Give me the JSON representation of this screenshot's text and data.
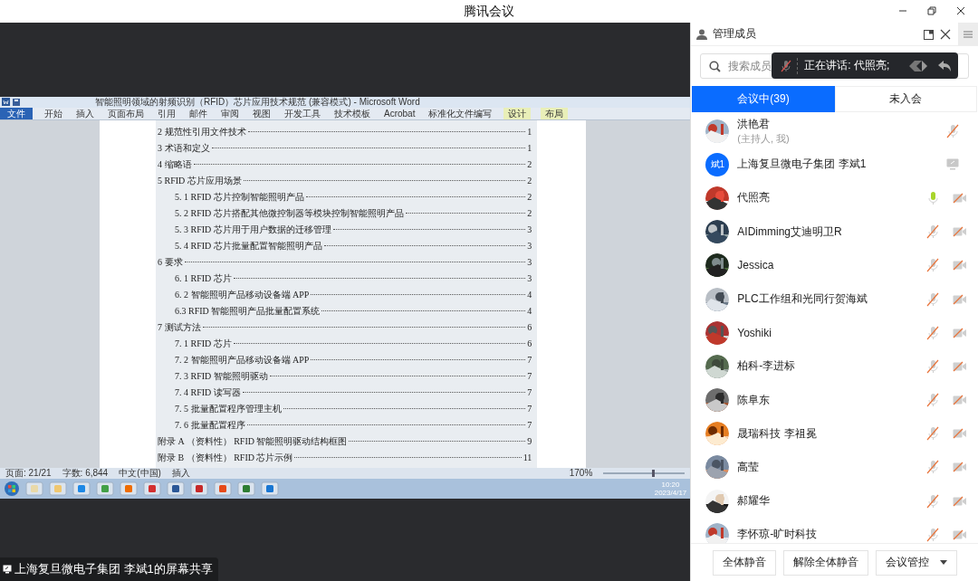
{
  "window": {
    "title": "腾讯会议"
  },
  "shared_screen": {
    "word_title": "智能照明领域的射频识别（RFID）芯片应用技术规范 (兼容模式) - Microsoft Word",
    "ribbon_tabs": [
      {
        "label": "文件",
        "kind": "file"
      },
      {
        "label": "开始",
        "kind": "tab"
      },
      {
        "label": "插入",
        "kind": "tab"
      },
      {
        "label": "页面布局",
        "kind": "tab"
      },
      {
        "label": "引用",
        "kind": "tab"
      },
      {
        "label": "邮件",
        "kind": "tab"
      },
      {
        "label": "审阅",
        "kind": "tab"
      },
      {
        "label": "视图",
        "kind": "tab"
      },
      {
        "label": "开发工具",
        "kind": "tab"
      },
      {
        "label": "技术模板",
        "kind": "tab"
      },
      {
        "label": "Acrobat",
        "kind": "tab"
      },
      {
        "label": "标准化文件编写",
        "kind": "tab"
      },
      {
        "label": "设计",
        "kind": "contextual"
      },
      {
        "label": "布局",
        "kind": "contextual"
      }
    ],
    "toc": [
      {
        "text": "2  规范性引用文件技术",
        "page": "1"
      },
      {
        "text": "3  术语和定义",
        "page": "1"
      },
      {
        "text": "4  缩略语",
        "page": "2"
      },
      {
        "text": "5 RFID 芯片应用场景",
        "page": "2",
        "children": [
          {
            "text": "5. 1 RFID 芯片控制智能照明产品",
            "page": "2"
          },
          {
            "text": "5. 2 RFID 芯片搭配其他微控制器等模块控制智能照明产品",
            "page": "2"
          },
          {
            "text": "5. 3 RFID 芯片用于用户数据的迁移管理",
            "page": "3"
          },
          {
            "text": "5. 4 RFID 芯片批量配置智能照明产品",
            "page": "3"
          }
        ]
      },
      {
        "text": "6  要求",
        "page": "3",
        "children": [
          {
            "text": "6. 1 RFID 芯片",
            "page": "3"
          },
          {
            "text": "6. 2  智能照明产品移动设备端 APP",
            "page": "4"
          },
          {
            "text": "6.3 RFID 智能照明产品批量配置系统",
            "page": "4"
          }
        ]
      },
      {
        "text": "7  测试方法",
        "page": "6",
        "children": [
          {
            "text": "7. 1 RFID 芯片",
            "page": "6"
          },
          {
            "text": "7. 2  智能照明产品移动设备端 APP",
            "page": "7"
          },
          {
            "text": "7. 3 RFID 智能照明驱动",
            "page": "7"
          },
          {
            "text": "7. 4 RFID 读写器",
            "page": "7"
          },
          {
            "text": "7. 5  批量配置程序管理主机",
            "page": "7"
          },
          {
            "text": "7. 6  批量配置程序",
            "page": "7"
          }
        ]
      },
      {
        "text": "附录 A （资料性） RFID 智能照明驱动结构框图",
        "page": "9"
      },
      {
        "text": "附录 B （资料性） RFID 芯片示例",
        "page": "11"
      }
    ],
    "status_bar": [
      "页面: 21/21",
      "字数: 6,844",
      "中文(中国)",
      "插入"
    ],
    "zoom": "170%",
    "zoom_slider": {
      "level": 0.6
    },
    "clock": {
      "time": "10:20",
      "date": "2023/4/17"
    },
    "sharer_label": "上海复旦微电子集团  李斌1的屏幕共享"
  },
  "panel": {
    "title": "管理成员",
    "search": {
      "placeholder": "搜索成员"
    },
    "speaking_toast": "正在讲话: 代照亮;",
    "tabs": [
      {
        "label": "会议中(39)",
        "selected": true
      },
      {
        "label": "未入会",
        "selected": false
      }
    ],
    "members": [
      {
        "kind": "host",
        "name": "洪艳君",
        "subtitle": "(主持人, 我)",
        "muted": true
      },
      {
        "kind": "sharer",
        "name": "上海复旦微电子集团  李斌1",
        "avatar": {
          "kind": "initials",
          "text": "斌1"
        }
      },
      {
        "kind": "participant",
        "name": "代照亮",
        "muted": false,
        "camera_off": true
      },
      {
        "kind": "participant",
        "name": "AIDimming艾迪明卫R",
        "muted": true,
        "camera_off": true
      },
      {
        "kind": "participant",
        "name": "Jessica",
        "muted": true,
        "camera_off": true
      },
      {
        "kind": "participant",
        "name": "PLC工作组和光同行贺海斌",
        "muted": true,
        "camera_off": true
      },
      {
        "kind": "participant",
        "name": "Yoshiki",
        "muted": true,
        "camera_off": true
      },
      {
        "kind": "participant",
        "name": "柏科-李进标",
        "muted": true,
        "camera_off": true
      },
      {
        "kind": "participant",
        "name": "陈阜东",
        "muted": true,
        "camera_off": true
      },
      {
        "kind": "participant",
        "name": "晟瑞科技 李祖冕",
        "muted": true,
        "camera_off": true
      },
      {
        "kind": "participant",
        "name": "高莹",
        "muted": true,
        "camera_off": true
      },
      {
        "kind": "participant",
        "name": "郝耀华",
        "muted": true,
        "camera_off": true
      },
      {
        "kind": "participant",
        "name": "李怀琼-旷时科技",
        "muted": true,
        "camera_off": true
      }
    ],
    "buttons": [
      {
        "label": "全体静音",
        "kind": "plain"
      },
      {
        "label": "解除全体静音",
        "kind": "plain"
      },
      {
        "label": "会议管控",
        "kind": "dropdown"
      }
    ]
  }
}
